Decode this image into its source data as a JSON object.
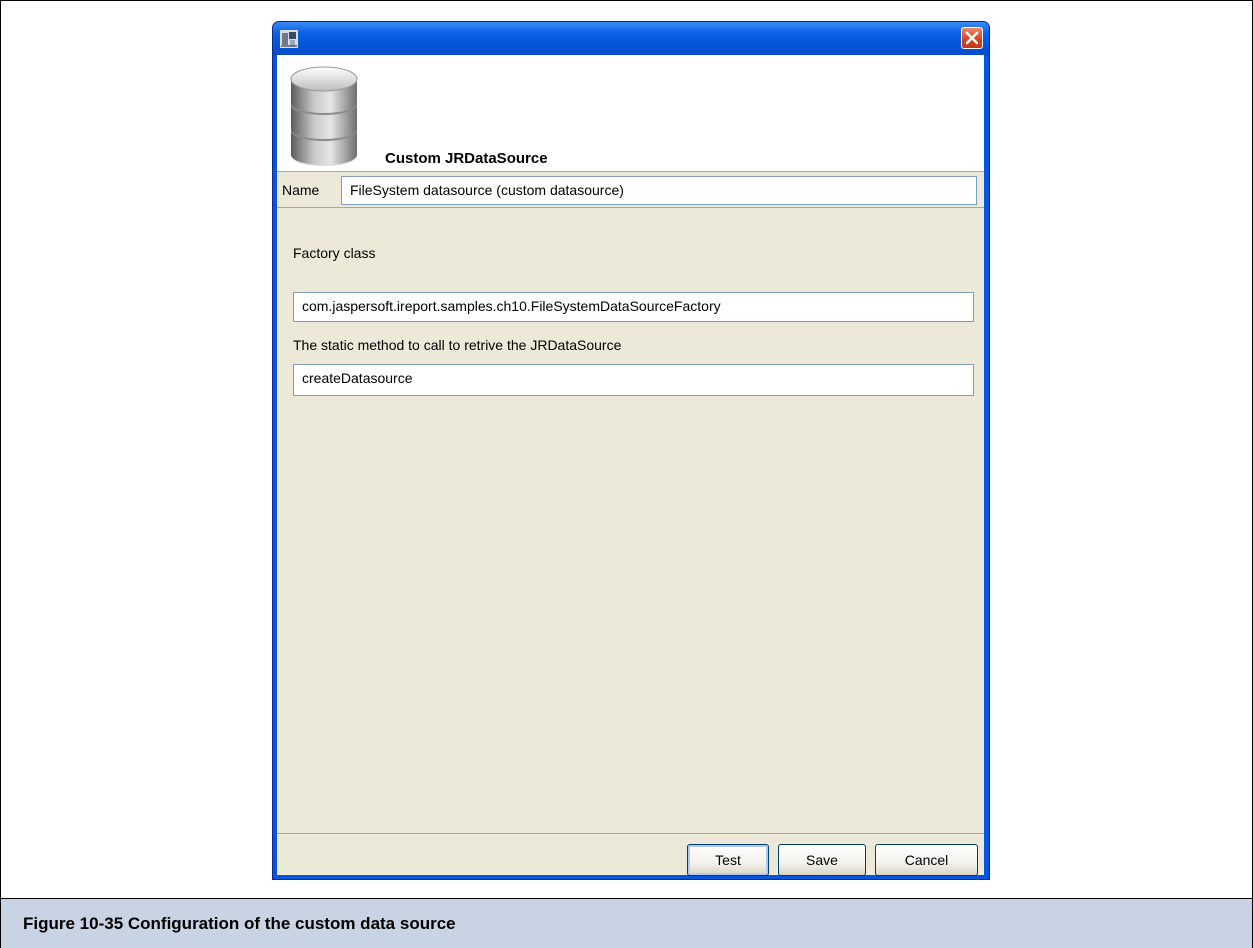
{
  "dialog": {
    "header_title": "Custom JRDataSource",
    "name_label": "Name",
    "name_value": "FileSystem datasource (custom datasource)",
    "factory_label": "Factory class",
    "factory_value": "com.jaspersoft.ireport.samples.ch10.FileSystemDataSourceFactory",
    "method_label": "The static method to call to retrive the JRDataSource",
    "method_value": "createDatasource",
    "buttons": {
      "test": "Test",
      "save": "Save",
      "cancel": "Cancel"
    }
  },
  "icons": {
    "app": "ireport-app-icon",
    "close": "close-icon",
    "header": "database-icon"
  },
  "colors": {
    "titlebar": "#0553d8",
    "close_button": "#d7451f",
    "dialog_body": "#ece9d8",
    "caption_bar": "#c8d4e4"
  },
  "caption": {
    "text": "Figure 10-35  Configuration of the custom data source"
  }
}
